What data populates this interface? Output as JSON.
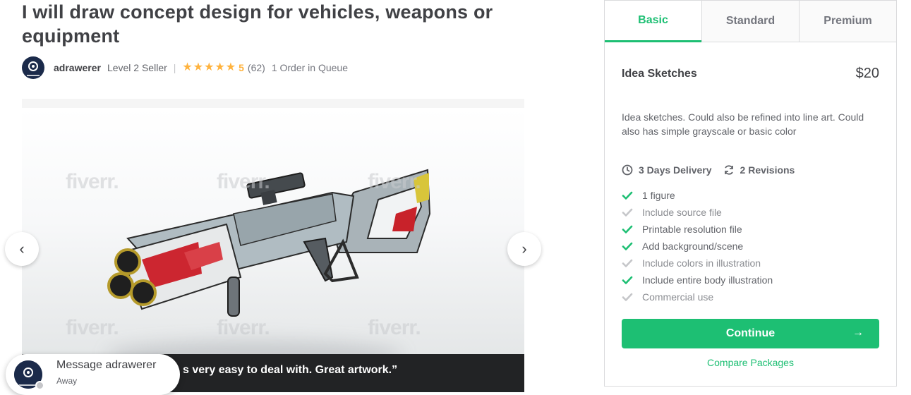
{
  "gig": {
    "title": "I will draw concept design for vehicles, weapons or equipment",
    "seller_name": "adrawerer",
    "seller_level": "Level 2 Seller",
    "separator": "|",
    "rating_stars": 5,
    "rating": "5",
    "review_count": "(62)",
    "queue": "1 Order in Queue"
  },
  "gallery": {
    "watermark": "fiverr.",
    "prev_icon": "chevron-left-icon",
    "next_icon": "chevron-right-icon",
    "quote": "s very easy to deal with. Great artwork.”"
  },
  "message": {
    "title": "Message adrawerer",
    "status": "Away"
  },
  "package": {
    "tabs": [
      {
        "label": "Basic",
        "active": true
      },
      {
        "label": "Standard",
        "active": false
      },
      {
        "label": "Premium",
        "active": false
      }
    ],
    "name": "Idea Sketches",
    "price": "$20",
    "description": "Idea sketches. Could also be refined into line art. Could also has simple grayscale or basic color",
    "delivery": "3 Days Delivery",
    "revisions": "2 Revisions",
    "features": [
      {
        "label": "1 figure",
        "included": true
      },
      {
        "label": "Include source file",
        "included": false
      },
      {
        "label": "Printable resolution file",
        "included": true
      },
      {
        "label": "Add background/scene",
        "included": true
      },
      {
        "label": "Include colors in illustration",
        "included": false
      },
      {
        "label": "Include entire body illustration",
        "included": true
      },
      {
        "label": "Commercial use",
        "included": false
      }
    ],
    "continue_label": "Continue",
    "continue_arrow": "→",
    "compare_label": "Compare Packages"
  },
  "colors": {
    "accent": "#1dbf73",
    "star": "#ffb33e",
    "check_off": "#c5c6c9"
  }
}
